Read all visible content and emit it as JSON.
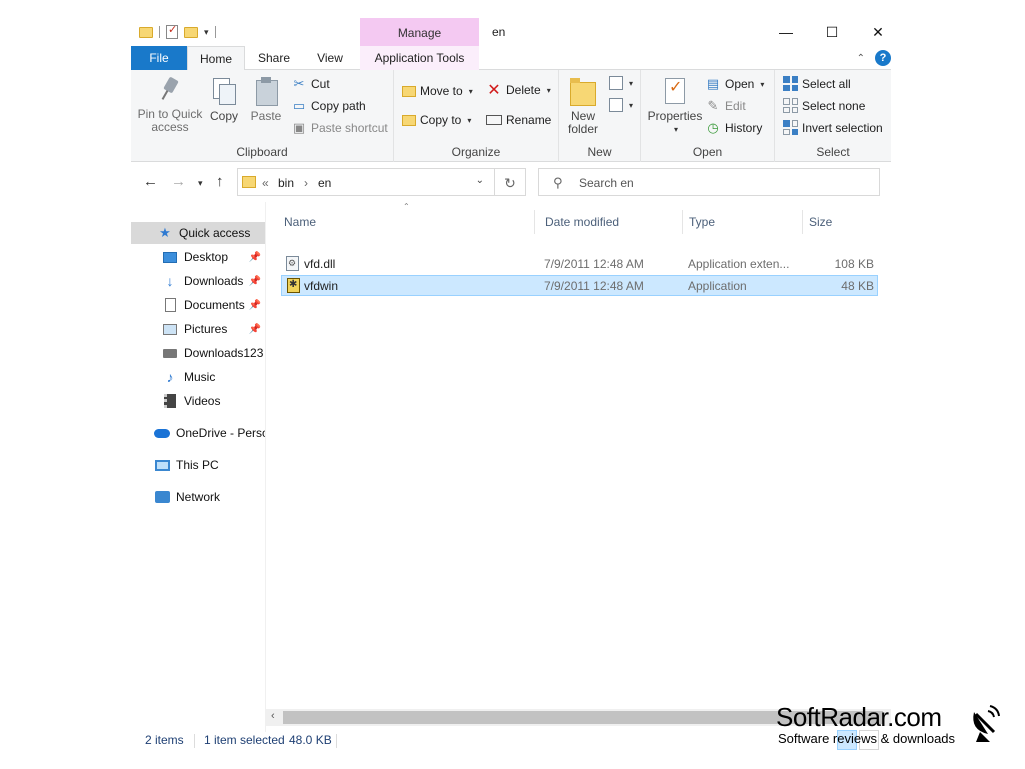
{
  "titlebar": {
    "title": "en",
    "context_tab_label": "Manage",
    "min_icon": "minimize-icon",
    "max_icon": "maximize-icon",
    "close_icon": "close-icon"
  },
  "ribbon_tabs": {
    "file": "File",
    "home": "Home",
    "share": "Share",
    "view": "View",
    "app_tools": "Application Tools"
  },
  "clipboard": {
    "label": "Clipboard",
    "pin_line1": "Pin to Quick",
    "pin_line2": "access",
    "copy": "Copy",
    "paste": "Paste",
    "cut": "Cut",
    "copy_path": "Copy path",
    "paste_shortcut": "Paste shortcut"
  },
  "organize": {
    "label": "Organize",
    "move_to": "Move to",
    "copy_to": "Copy to",
    "delete": "Delete",
    "rename": "Rename"
  },
  "new_group": {
    "label": "New",
    "new_folder_line1": "New",
    "new_folder_line2": "folder"
  },
  "open_group": {
    "label": "Open",
    "properties": "Properties",
    "open": "Open",
    "edit": "Edit",
    "history": "History"
  },
  "select_group": {
    "label": "Select",
    "select_all": "Select all",
    "select_none": "Select none",
    "invert": "Invert selection"
  },
  "address": {
    "overflow": "«",
    "crumbs": [
      "bin",
      "en"
    ],
    "separator": "›"
  },
  "search": {
    "placeholder": "Search en"
  },
  "nav_pane": {
    "items": [
      {
        "label": "Quick access",
        "icon": "star-icon"
      },
      {
        "label": "Desktop",
        "icon": "desktop-icon"
      },
      {
        "label": "Downloads",
        "icon": "download-icon"
      },
      {
        "label": "Documents",
        "icon": "document-icon"
      },
      {
        "label": "Pictures",
        "icon": "pictures-icon"
      },
      {
        "label": "Downloads123",
        "icon": "drive-icon"
      },
      {
        "label": "Music",
        "icon": "music-icon"
      },
      {
        "label": "Videos",
        "icon": "video-icon"
      },
      {
        "label": "OneDrive - Perso",
        "icon": "cloud-icon"
      },
      {
        "label": "This PC",
        "icon": "computer-icon"
      },
      {
        "label": "Network",
        "icon": "network-icon"
      }
    ]
  },
  "file_list": {
    "columns": {
      "name": "Name",
      "date": "Date modified",
      "type": "Type",
      "size": "Size"
    },
    "rows": [
      {
        "name": "vfd.dll",
        "date": "7/9/2011 12:48 AM",
        "type": "Application exten...",
        "size": "108 KB"
      },
      {
        "name": "vfdwin",
        "date": "7/9/2011 12:48 AM",
        "type": "Application",
        "size": "48 KB"
      }
    ]
  },
  "status": {
    "items_count": "2 items",
    "selected": "1 item selected",
    "selected_size": "48.0 KB"
  },
  "watermark": {
    "title": "SoftRadar.com",
    "subtitle": "Software reviews & downloads"
  },
  "colors": {
    "accent": "#1979ca",
    "manage_tab": "#f4c9f2",
    "selection": "#cce8ff"
  }
}
